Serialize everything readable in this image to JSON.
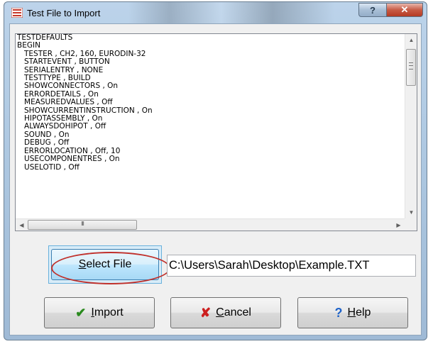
{
  "window": {
    "title": "Test File to Import",
    "help_caption": "?",
    "close_caption": "✕"
  },
  "textbox": {
    "lines": [
      "TESTDEFAULTS",
      "BEGIN",
      "   TESTER , CH2, 160, EURODIN-32",
      "   STARTEVENT , BUTTON",
      "   SERIALENTRY , NONE",
      "   TESTTYPE , BUILD",
      "   SHOWCONNECTORS , On",
      "   ERRORDETAILS , On",
      "   MEASUREDVALUES , Off",
      "   SHOWCURRENTINSTRUCTION , On",
      "   HIPOTASSEMBLY , On",
      "   ALWAYSDOHIPOT , Off",
      "   SOUND , On",
      "   DEBUG , Off",
      "   ERRORLOCATION , Off, 10",
      "   USECOMPONENTRES , On",
      "   USELOTID , Off"
    ],
    "hscroll_thumb_grip": "III"
  },
  "select_file": {
    "label_underlined": "S",
    "label_rest": "elect File",
    "path_value": "C:\\Users\\Sarah\\Desktop\\Example.TXT"
  },
  "buttons": {
    "import": {
      "icon": "✔",
      "underlined": "I",
      "rest": "mport"
    },
    "cancel": {
      "icon": "✘",
      "underlined": "C",
      "rest": "ancel"
    },
    "help": {
      "icon": "?",
      "underlined": "H",
      "rest": "elp"
    }
  },
  "colors": {
    "highlight_oval": "#c0302b",
    "import_icon": "#2a8a1e",
    "cancel_icon": "#cc1f1f",
    "help_icon": "#1f63c9"
  }
}
